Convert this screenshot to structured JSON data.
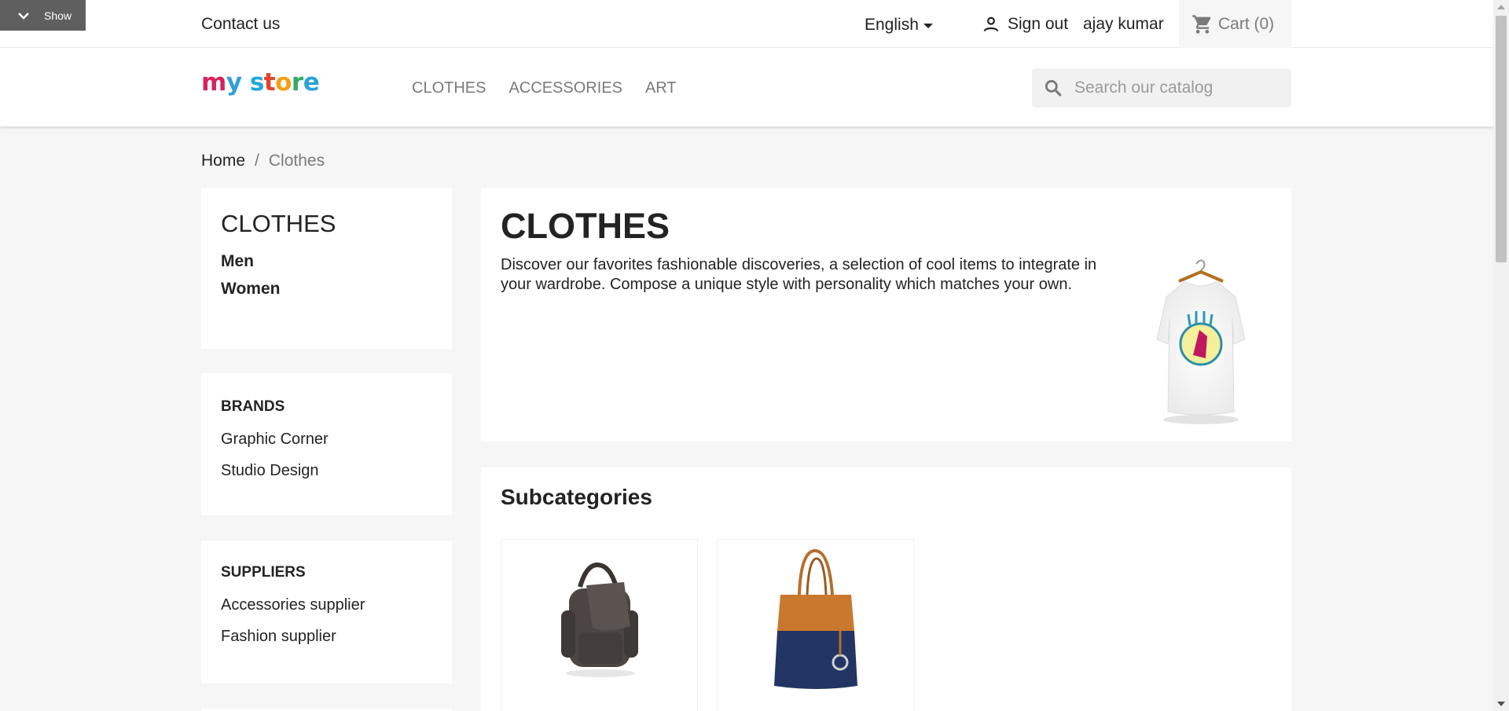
{
  "debug": {
    "label": "Show",
    "icon": "chevron-down-icon"
  },
  "topbar": {
    "contact": "Contact us",
    "language": "English",
    "signout": "Sign out",
    "username": "ajay kumar",
    "cart": "Cart (0)"
  },
  "header": {
    "logo": {
      "text": "my store",
      "letters": [
        "m",
        "y",
        " ",
        "s",
        "t",
        "o",
        "r",
        "e"
      ],
      "colors": [
        "#d6245a",
        "#2fa0d8",
        "",
        "#1fa7e0",
        "#e4412e",
        "#f2a018",
        "#35a86a",
        "#2aa2d8"
      ]
    },
    "nav": [
      "CLOTHES",
      "ACCESSORIES",
      "ART"
    ],
    "search_placeholder": "Search our catalog"
  },
  "breadcrumb": {
    "home": "Home",
    "separator": "/",
    "current": "Clothes"
  },
  "sidebar": {
    "category": {
      "title": "CLOTHES",
      "items": [
        "Men",
        "Women"
      ]
    },
    "brands": {
      "title": "BRANDS",
      "items": [
        "Graphic Corner",
        "Studio Design"
      ]
    },
    "suppliers": {
      "title": "SUPPLIERS",
      "items": [
        "Accessories supplier",
        "Fashion supplier"
      ]
    }
  },
  "main": {
    "title": "CLOTHES",
    "description": "Discover our favorites fashionable discoveries, a selection of cool items to integrate in your wardrobe. Compose a unique style with personality which matches your own."
  },
  "subcategories": {
    "title": "Subcategories",
    "thumbs": [
      "backpack-image",
      "tote-bag-image"
    ]
  },
  "colors": {
    "accent": "#24b9d7",
    "text": "#232323",
    "muted": "#7a7a7a",
    "background": "#f6f6f6"
  }
}
